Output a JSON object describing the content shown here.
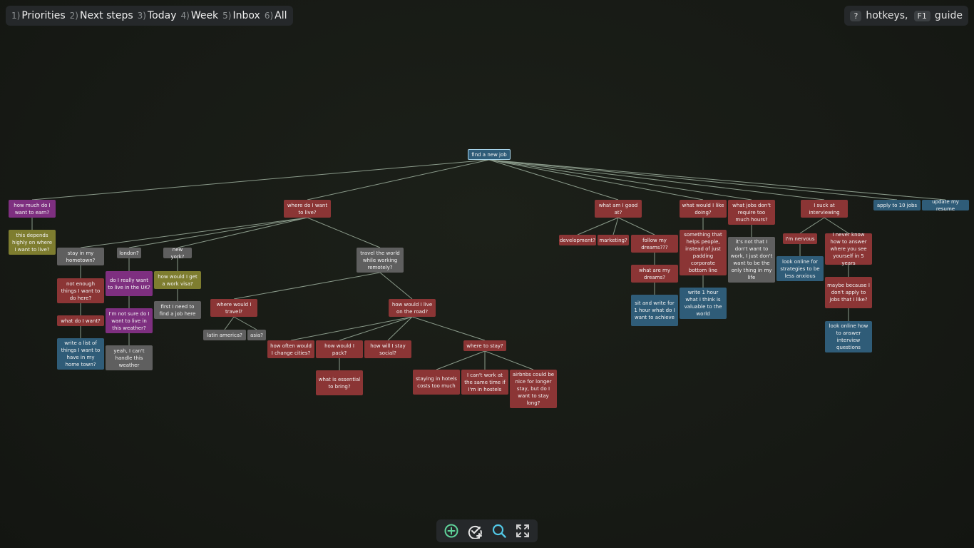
{
  "nav": [
    {
      "num": "1)",
      "label": "Priorities"
    },
    {
      "num": "2)",
      "label": "Next steps"
    },
    {
      "num": "3)",
      "label": "Today"
    },
    {
      "num": "4)",
      "label": "Week"
    },
    {
      "num": "5)",
      "label": "Inbox"
    },
    {
      "num": "6)",
      "label": "All"
    }
  ],
  "help": {
    "key1": "?",
    "text1": "hotkeys,",
    "key2": "F1",
    "text2": "guide"
  },
  "colors": {
    "red": "#8b3535",
    "gray": "#5f5f5f",
    "blue": "#2f5c78",
    "purple": "#7e2f80",
    "olive": "#7e7d2f",
    "edge": "#8a9a8a"
  },
  "nodes": {
    "root": "find a new job",
    "earn": "how much do I want to earn?",
    "depends": "this depends highly on where I want to live?",
    "live": "where do I want to live?",
    "hometown": "stay in my hometown?",
    "london": "london?",
    "newyork": "new york?",
    "travel": "travel the world while working remotely?",
    "notenough": "not enough things I want to do here?",
    "whatdo": "what do I want?",
    "writelist": "write a list of things I want to have in my home town?",
    "reallyuk": "do I really want to live in the UK?",
    "notsure": "I'm not sure do I want to live in this weather?",
    "handle": "yeah, I can't handle this weather",
    "workvisa": "how would I get a work visa?",
    "firstjob": "first I need to find a job here",
    "wheretravel": "where would I travel?",
    "latam": "latin america?",
    "asia": "asia?",
    "liveroad": "how would I live on the road?",
    "howoften": "how often would I change cities?",
    "pack": "how would I pack?",
    "essential": "what is essential to bring?",
    "social": "how will I stay social?",
    "stay": "where to stay?",
    "hotels": "staying in hotels costs too much",
    "hostels": "I can't work at the same time if I'm in hostels",
    "airbnb": "airbnbs could be nice for longer stay, but do I want to stay long?",
    "goodat": "what am I good at?",
    "development": "development?",
    "marketing": "marketing?",
    "follow": "follow my dreams???",
    "dreams": "what are my dreams?",
    "sitwrite": "sit and write for 1 hour what do I want to achieve",
    "likedoing": "what would I like doing?",
    "helps": "something that helps people, instead of just padding corporate bottom line",
    "write1h": "write 1 hour what I think is valuable to the world",
    "nohours": "what jobs don't require too much hours?",
    "notthat": "it's not that I don't want to work, I just don't want to be the only thing in my life",
    "interview": "I suck at interviewing",
    "nervous": "I'm nervous",
    "strategies": "look online for strategies to be less anxious",
    "fiveyears": "I never know how to answer where you see yourself in 5 years",
    "maybe": "maybe because I don't apply to jobs that I like?",
    "lookonline": "look online how to answer interview questions",
    "apply": "apply to 10 jobs",
    "resume": "update my resume"
  },
  "toolbar": [
    "add-icon",
    "add-check-icon",
    "search-icon",
    "fullscreen-icon"
  ]
}
